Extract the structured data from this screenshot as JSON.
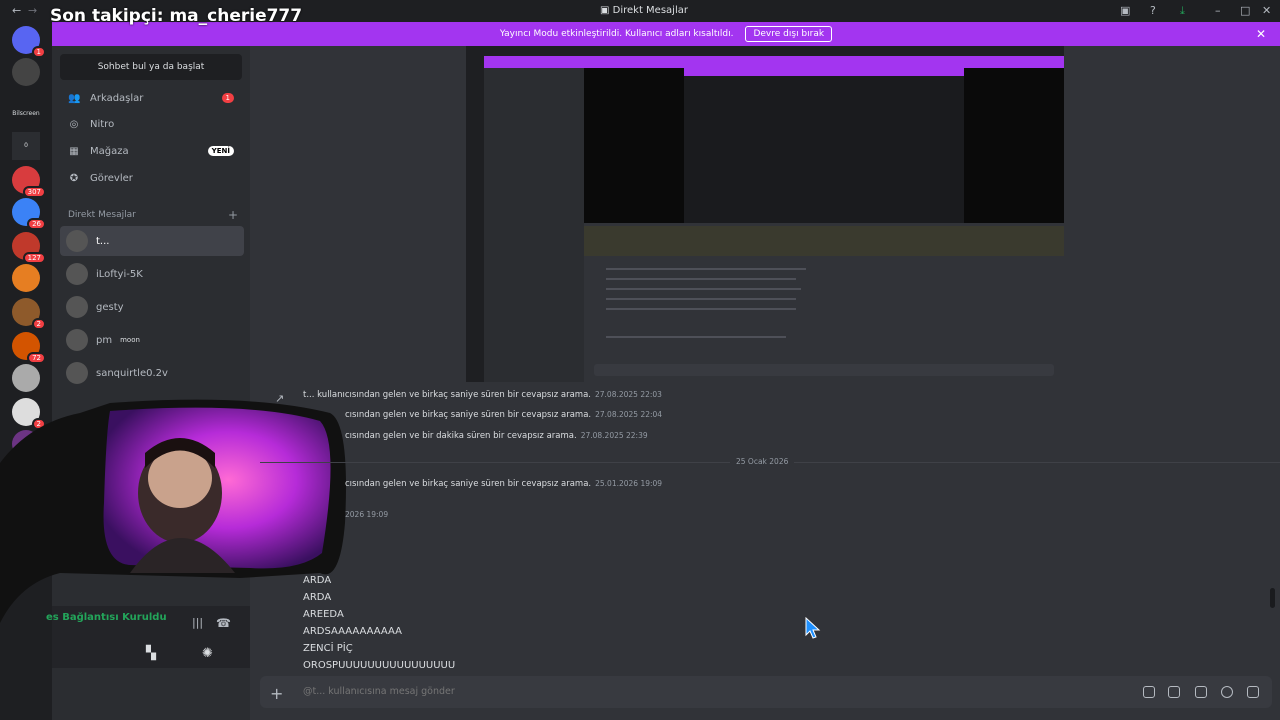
{
  "overlay": {
    "follower_text": "Son takipçi: ma_cherie777"
  },
  "window": {
    "title": "Direkt Mesajlar",
    "back": "←",
    "forward": "→"
  },
  "banner": {
    "text": "Yayıncı Modu etkinleştirildi. Kullanıcı adları kısaltıldı.",
    "button": "Devre dışı bırak"
  },
  "servers": [
    {
      "name": "discord-home-icon",
      "badge": "1",
      "color": "#5865f2"
    },
    {
      "name": "server-avatar",
      "badge": "",
      "color": "#444"
    },
    {
      "name": "server-text",
      "label": "Bilscreen",
      "color": "#1e1f22"
    },
    {
      "name": "server-zero",
      "label": "0",
      "color": "#2b2d31"
    },
    {
      "name": "server-1",
      "badge": "307",
      "color": "#d83c3e"
    },
    {
      "name": "server-2",
      "badge": "26",
      "color": "#3b82f6"
    },
    {
      "name": "server-3",
      "badge": "127",
      "color": "#c0392b"
    },
    {
      "name": "server-4",
      "badge": "",
      "color": "#e67e22"
    },
    {
      "name": "server-5",
      "badge": "2",
      "color": "#8e5a2b"
    },
    {
      "name": "server-6",
      "badge": "72",
      "color": "#d35400"
    },
    {
      "name": "server-7",
      "badge": "",
      "color": "#aaa"
    },
    {
      "name": "server-8",
      "badge": "2",
      "color": "#ddd"
    },
    {
      "name": "server-9",
      "badge": "",
      "color": "#6c3483"
    },
    {
      "name": "server-10",
      "badge": "",
      "color": "#7f6a4d"
    },
    {
      "name": "server-11",
      "badge": "",
      "color": "#a93226"
    }
  ],
  "sidebar": {
    "find_button": "Sohbet bul ya da başlat",
    "nav": [
      {
        "label": "Arkadaşlar",
        "icon": "friends-icon",
        "glyph": "👥",
        "badge": "1"
      },
      {
        "label": "Nitro",
        "icon": "nitro-icon",
        "glyph": "◎",
        "badge": ""
      },
      {
        "label": "Mağaza",
        "icon": "shop-icon",
        "glyph": "▦",
        "badge": "YENİ"
      },
      {
        "label": "Görevler",
        "icon": "quests-icon",
        "glyph": "✪",
        "badge": ""
      }
    ],
    "dm_header": "Direkt Mesajlar",
    "dm_add": "+",
    "dms": [
      {
        "name": "t...",
        "active": true,
        "extra": ""
      },
      {
        "name": "iLoftyi-5K",
        "active": false,
        "extra": ""
      },
      {
        "name": "gesty",
        "active": false,
        "extra": ""
      },
      {
        "name": "pm",
        "active": false,
        "extra": "moon"
      },
      {
        "name": "sanquirtle0.2v",
        "active": false,
        "extra": ""
      }
    ],
    "voice_status": "es Bağlantısı Kuruldu"
  },
  "messages": [
    {
      "text": "t... kullanıcısından gelen ve birkaç saniye süren bir cevapsız arama.",
      "ts": "27.08.2025 22:03"
    },
    {
      "text": "cısından gelen ve birkaç saniye süren bir cevapsız arama.",
      "ts": "27.08.2025 22:04"
    },
    {
      "text": "cısından gelen ve bir dakika süren bir cevapsız arama.",
      "ts": "27.08.2025 22:39"
    }
  ],
  "date_divider": "25 Ocak 2026",
  "messages2": [
    {
      "text": "cısından gelen ve birkaç saniye süren bir cevapsız arama.",
      "ts": "25.01.2026 19:09"
    }
  ],
  "partial_ts": "2026 19:09",
  "chat_lines": [
    "ARDA",
    "ARDA",
    "AREEDA",
    "ARDSAAAAAAAAAA",
    "ZENCİ PİÇ",
    "OROSPUUUUUUUUUUUUUUUU"
  ],
  "composer": {
    "placeholder": "@t... kullanıcısına mesaj gönder",
    "plus": "+"
  }
}
